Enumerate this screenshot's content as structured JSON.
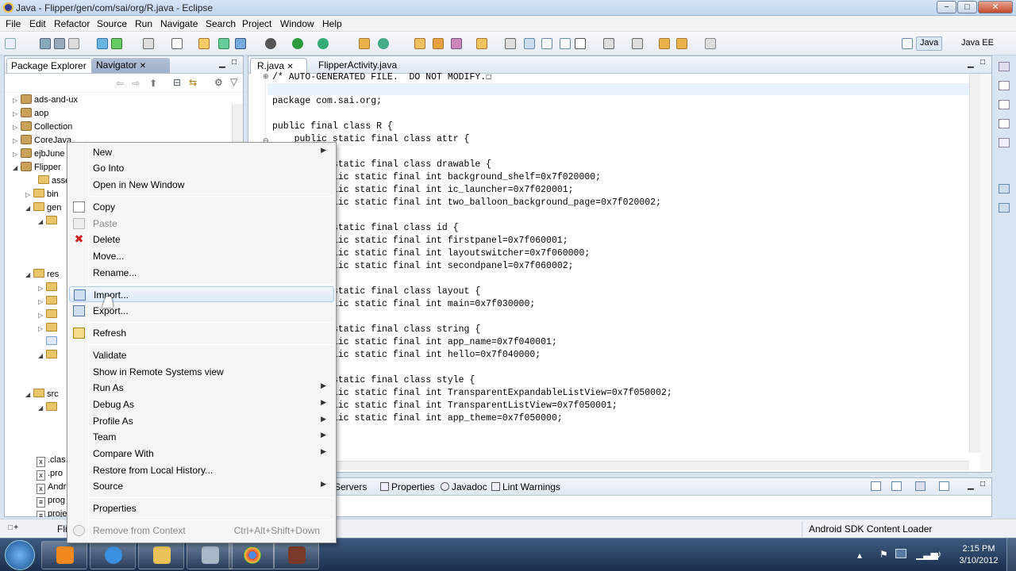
{
  "window": {
    "title": "Java - Flipper/gen/com/sai/org/R.java - Eclipse"
  },
  "menubar": [
    "File",
    "Edit",
    "Refactor",
    "Source",
    "Run",
    "Navigate",
    "Search",
    "Project",
    "Window",
    "Help"
  ],
  "perspectives": {
    "java": "Java",
    "javaee": "Java EE"
  },
  "left_view": {
    "tabs": [
      "Package Explorer",
      "Navigator"
    ],
    "tree": [
      {
        "label": "ads-and-ux",
        "indent": 0,
        "icon": "project"
      },
      {
        "label": "aop",
        "indent": 0,
        "icon": "project"
      },
      {
        "label": "Collection",
        "indent": 0,
        "icon": "project"
      },
      {
        "label": "CoreJava",
        "indent": 0,
        "icon": "project"
      },
      {
        "label": "ejbJune",
        "indent": 0,
        "icon": "project"
      },
      {
        "label": "Flipper",
        "indent": 0,
        "icon": "project"
      },
      {
        "label": "asse",
        "indent": 1,
        "icon": "folder"
      },
      {
        "label": "bin",
        "indent": 1,
        "icon": "folder"
      },
      {
        "label": "gen",
        "indent": 1,
        "icon": "folder"
      },
      {
        "label": "res",
        "indent": 1,
        "icon": "folder"
      },
      {
        "label": "src",
        "indent": 1,
        "icon": "folder"
      },
      {
        "label": ".clas",
        "indent": 1,
        "icon": "file-x"
      },
      {
        "label": ".pro",
        "indent": 1,
        "icon": "file-x"
      },
      {
        "label": "Andr",
        "indent": 1,
        "icon": "file-x"
      },
      {
        "label": "prog",
        "indent": 1,
        "icon": "file"
      },
      {
        "label": "proje",
        "indent": 1,
        "icon": "file"
      }
    ],
    "status_text": "Fli"
  },
  "editor": {
    "tabs": [
      "R.java",
      "FlipperActivity.java"
    ],
    "lines": [
      "/* AUTO-GENERATED FILE.  DO NOT MODIFY.☐",
      "",
      "package com.sai.org;",
      "",
      "public final class R {",
      "    public static final class attr {",
      "    }",
      "    public static final class drawable {",
      "        public static final int background_shelf=0x7f020000;",
      "        public static final int ic_launcher=0x7f020001;",
      "        public static final int two_balloon_background_page=0x7f020002;",
      "    }",
      "    public static final class id {",
      "        public static final int firstpanel=0x7f060001;",
      "        public static final int layoutswitcher=0x7f060000;",
      "        public static final int secondpanel=0x7f060002;",
      "    }",
      "    public static final class layout {",
      "        public static final int main=0x7f030000;",
      "    }",
      "    public static final class string {",
      "        public static final int app_name=0x7f040001;",
      "        public static final int hello=0x7f040000;",
      "    }",
      "    public static final class style {",
      "        public static final int TransparentExpandableListView=0x7f050002;",
      "        public static final int TransparentListView=0x7f050001;",
      "        public static final int app_theme=0x7f050000;"
    ]
  },
  "bottom_view": {
    "tabs": [
      "Servers",
      "Properties",
      "Javadoc",
      "Lint Warnings"
    ]
  },
  "status_bar": {
    "right": "Android SDK Content Loader"
  },
  "context_menu": {
    "items": [
      {
        "label": "New",
        "submenu": true
      },
      {
        "label": "Go Into"
      },
      {
        "label": "Open in New Window"
      },
      {
        "sep": true
      },
      {
        "label": "Copy",
        "icon": "copy-icon"
      },
      {
        "label": "Paste",
        "icon": "paste-icon",
        "disabled": true
      },
      {
        "label": "Delete",
        "icon": "delete-icon"
      },
      {
        "label": "Move..."
      },
      {
        "label": "Rename..."
      },
      {
        "sep": true
      },
      {
        "label": "Import...",
        "icon": "import-icon",
        "highlighted": true
      },
      {
        "label": "Export...",
        "icon": "export-icon"
      },
      {
        "sep": true
      },
      {
        "label": "Refresh",
        "icon": "refresh-icon"
      },
      {
        "sep": true
      },
      {
        "label": "Validate"
      },
      {
        "label": "Show in Remote Systems view"
      },
      {
        "label": "Run As",
        "submenu": true
      },
      {
        "label": "Debug As",
        "submenu": true
      },
      {
        "label": "Profile As",
        "submenu": true
      },
      {
        "label": "Team",
        "submenu": true
      },
      {
        "label": "Compare With",
        "submenu": true
      },
      {
        "label": "Restore from Local History..."
      },
      {
        "label": "Source",
        "submenu": true
      },
      {
        "sep": true
      },
      {
        "label": "Properties"
      },
      {
        "sep": true
      },
      {
        "label": "Remove from Context",
        "icon": "context-icon",
        "disabled": true,
        "shortcut": "Ctrl+Alt+Shift+Down"
      }
    ]
  },
  "taskbar": {
    "apps": [
      "start-orb",
      "media-player",
      "internet-explorer",
      "windows-explorer",
      "eclipse",
      "chrome",
      "game"
    ],
    "clock": {
      "time": "2:15 PM",
      "date": "3/10/2012"
    }
  },
  "colors": {
    "accent": "#c7dcf5",
    "taskbar": "#2b4468",
    "highlight": "#dce9fa"
  }
}
